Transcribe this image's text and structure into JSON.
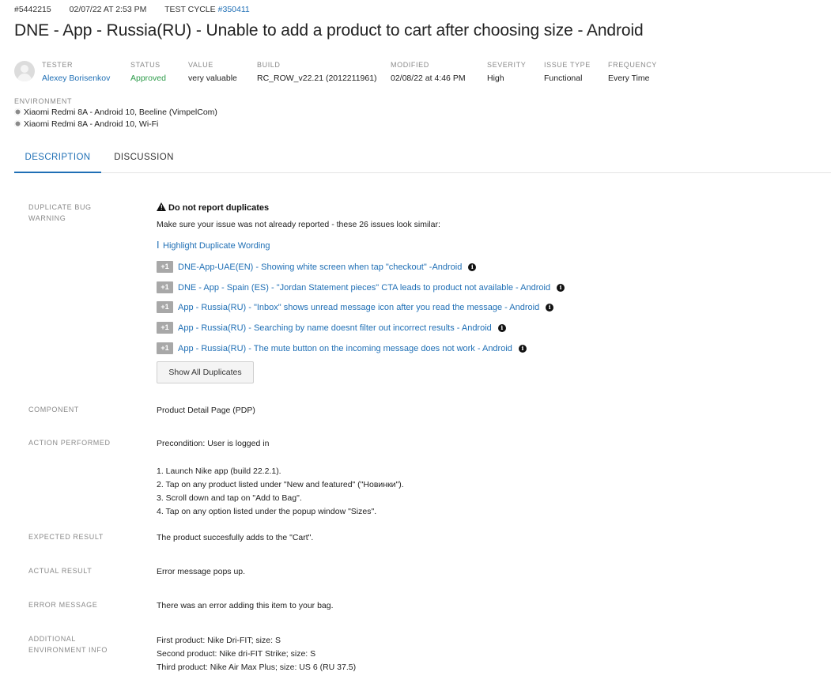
{
  "header": {
    "issue_id": "#5442215",
    "created": "02/07/22 AT 2:53 PM",
    "test_cycle_label": "TEST CYCLE",
    "test_cycle_link": "#350411",
    "title": "DNE - App - Russia(RU) - Unable to add a product to cart after choosing size - Android"
  },
  "meta": {
    "tester_label": "TESTER",
    "tester": "Alexey Borisenkov",
    "status_label": "STATUS",
    "status": "Approved",
    "value_label": "VALUE",
    "value": "very valuable",
    "build_label": "BUILD",
    "build": "RC_ROW_v22.21 (2012211961)",
    "modified_label": "MODIFIED",
    "modified": "02/08/22 at 4:46 PM",
    "severity_label": "SEVERITY",
    "severity": "High",
    "issue_type_label": "ISSUE TYPE",
    "issue_type": "Functional",
    "frequency_label": "FREQUENCY",
    "frequency": "Every Time",
    "status_color": "#2e9c4b",
    "link_color": "#1f6fb5"
  },
  "environment": {
    "label": "ENVIRONMENT",
    "items": [
      "Xiaomi Redmi 8A - Android 10, Beeline (VimpelCom)",
      "Xiaomi Redmi 8A - Android 10, Wi-Fi"
    ],
    "icon": "android-icon"
  },
  "tabs": [
    {
      "label": "DESCRIPTION",
      "active": true
    },
    {
      "label": "DISCUSSION",
      "active": false
    }
  ],
  "duplicate_warning": {
    "label": "DUPLICATE BUG WARNING",
    "title": "Do not report duplicates",
    "text": "Make sure your issue was not already reported - these 26 issues look similar:",
    "highlight_link": "Highlight Duplicate Wording",
    "plus_label": "+1",
    "items": [
      "DNE-App-UAE(EN) - Showing white screen when tap \"checkout\" -Android",
      "DNE - App - Spain (ES) - \"Jordan Statement pieces\" CTA leads to product not available - Android",
      "App - Russia(RU) - \"Inbox\" shows unread message icon after you read the message - Android",
      "App - Russia(RU) - Searching by name doesnt filter out incorrect results - Android",
      "App - Russia(RU) - The mute button on the incoming message does not work - Android"
    ],
    "show_all_button": "Show All Duplicates"
  },
  "fields": {
    "component_label": "COMPONENT",
    "component": "Product Detail Page (PDP)",
    "action_label": "ACTION PERFORMED",
    "precondition": "Precondition: User is logged in",
    "steps": [
      "1. Launch Nike app (build 22.2.1).",
      "2. Tap on any product listed under \"New and featured\" (\"Новинки\").",
      "3. Scroll down and tap on \"Add to Bag\".",
      "4. Tap on any option listed under the popup window \"Sizes\"."
    ],
    "expected_label": "EXPECTED RESULT",
    "expected": "The product succesfully adds to the \"Cart\".",
    "actual_label": "ACTUAL RESULT",
    "actual": "Error message pops up.",
    "error_label": "ERROR MESSAGE",
    "error": "There was an error adding this item to your bag.",
    "additional_label": "ADDITIONAL ENVIRONMENT INFO",
    "additional": [
      "First product: Nike Dri-FIT; size: S",
      "Second product: Nike dri-FIT Strike; size: S",
      "Third product: Nike Air Max Plus; size: US 6 (RU 37.5)"
    ]
  }
}
